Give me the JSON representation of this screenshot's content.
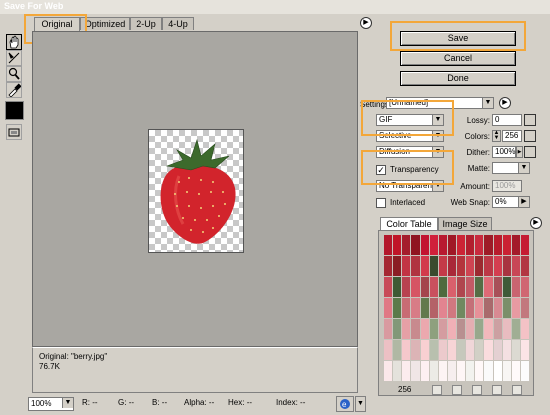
{
  "window": {
    "title": "Save For Web"
  },
  "tabs": [
    {
      "label": "Original"
    },
    {
      "label": "Optimized"
    },
    {
      "label": "2-Up"
    },
    {
      "label": "4-Up"
    }
  ],
  "tools": [
    "hand-icon",
    "slice-select-icon",
    "zoom-icon",
    "eyedropper-icon",
    "color-swatch",
    "preview-toggle-icon"
  ],
  "image_info": {
    "line1": "Original: \"berry.jpg\"",
    "line2": "76.7K"
  },
  "buttons": {
    "save": "Save",
    "cancel": "Cancel",
    "done": "Done"
  },
  "settings": {
    "label": "Settings:",
    "value": "[Unnamed]",
    "format": "GIF",
    "reduction": "Selective",
    "dither_algorithm": "Diffusion",
    "transparency_label": "Transparency",
    "transparency_checked": true,
    "transparency_dither": "No Transparen",
    "interlaced_label": "Interlaced",
    "interlaced_checked": false,
    "lossy_label": "Lossy:",
    "lossy_value": "0",
    "colors_label": "Colors:",
    "colors_value": "256",
    "dither_label": "Dither:",
    "dither_value": "100%",
    "matte_label": "Matte:",
    "amount_label": "Amount:",
    "amount_value": "100%",
    "websnap_label": "Web Snap:",
    "websnap_value": "0%"
  },
  "color_table": {
    "tabs": [
      "Color Table",
      "Image Size"
    ],
    "count": "256",
    "palette": [
      "#b3172b",
      "#c01528",
      "#a41d2b",
      "#8f1420",
      "#c21430",
      "#d0203a",
      "#b81930",
      "#a01826",
      "#cc2435",
      "#b21e2e",
      "#c92a3e",
      "#9e1b27",
      "#b81c2c",
      "#ca2233",
      "#a31a2a",
      "#c51c32",
      "#a52832",
      "#8a1e24",
      "#c23444",
      "#b03440",
      "#d23a4c",
      "#3b4a2e",
      "#c43a48",
      "#a92838",
      "#b4343c",
      "#cf4452",
      "#9c2a30",
      "#bc3846",
      "#d43e50",
      "#a83440",
      "#c84656",
      "#b23642",
      "#c84a58",
      "#3e5a34",
      "#b84250",
      "#d65464",
      "#a4444c",
      "#c9505e",
      "#4f6a3e",
      "#d9606c",
      "#b0464e",
      "#c45a66",
      "#556d45",
      "#de6a76",
      "#a85058",
      "#3f5b38",
      "#c96470",
      "#d06672",
      "#e07884",
      "#5b7a4a",
      "#c86c74",
      "#d87c86",
      "#62794d",
      "#b46268",
      "#e28490",
      "#d17880",
      "#708960",
      "#c47078",
      "#e69098",
      "#a96a6c",
      "#d88a92",
      "#7b8f6a",
      "#e89aa2",
      "#c2787e",
      "#d99aa0",
      "#829878",
      "#e6a0a6",
      "#c88a8e",
      "#eba8ae",
      "#8ea07e",
      "#d49ca0",
      "#f0b0b6",
      "#b89090",
      "#e4aeb2",
      "#97a88c",
      "#f2b8bc",
      "#cca0a2",
      "#e9bcc0",
      "#a0ae94",
      "#f4c2c6",
      "#ecc0c4",
      "#b0b8a4",
      "#f6c8cc",
      "#dcb4b6",
      "#f8d0d2",
      "#b8c0ae",
      "#eccacc",
      "#f7d4d6",
      "#c6c8bc",
      "#f0d6d8",
      "#d2d0c6",
      "#fadcde",
      "#e4d0d2",
      "#f4e0e2",
      "#dcdad2",
      "#fbe4e6",
      "#fbe8ea",
      "#e4e2dc",
      "#fcecee",
      "#f0e6e6",
      "#fdf0f2",
      "#ecebe6",
      "#fdf4f4",
      "#f6eeee",
      "#fef6f6",
      "#f2f2ee",
      "#fff8f8",
      "#fafafa",
      "#ffffff",
      "#f8f6f4",
      "#fffafa",
      "#fcfcfc"
    ]
  },
  "status_bar": {
    "zoom": "100%",
    "r": "R:",
    "r_val": "--",
    "g": "G:",
    "g_val": "--",
    "b": "B:",
    "b_val": "--",
    "alpha": "Alpha:",
    "alpha_val": "--",
    "hex": "Hex:",
    "hex_val": "--",
    "index": "Index:",
    "index_val": "--"
  }
}
